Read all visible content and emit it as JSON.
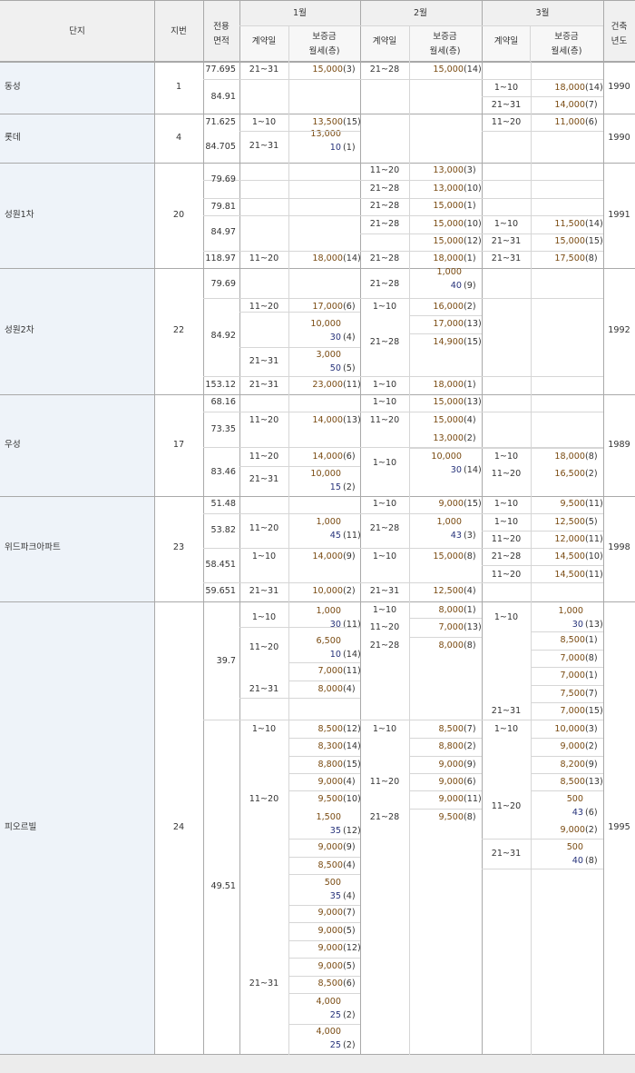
{
  "header": {
    "complex": "단지",
    "lot": "지번",
    "area": "전용\n면적",
    "contract": "계약일",
    "price": "보증금\n월세(층)",
    "year": "건축\n년도",
    "months": [
      "1월",
      "2월",
      "3월"
    ]
  },
  "complexes": [
    {
      "name": "동성",
      "lot": "1",
      "year": "1990"
    },
    {
      "name": "롯데",
      "lot": "4",
      "year": "1990"
    },
    {
      "name": "성원1차",
      "lot": "20",
      "year": "1991"
    },
    {
      "name": "성원2차",
      "lot": "22",
      "year": "1992"
    },
    {
      "name": "우성",
      "lot": "17",
      "year": "1989"
    },
    {
      "name": "위드파크아파트",
      "lot": "23",
      "year": "1998"
    },
    {
      "name": "피오르빌",
      "lot": "24",
      "year": "1995"
    }
  ],
  "areas": [
    "77.695",
    "84.91",
    "71.625",
    "84.705",
    "79.69",
    "79.81",
    "84.97",
    "118.97",
    "79.69",
    "84.92",
    "153.12",
    "68.16",
    "73.35",
    "83.46",
    "51.48",
    "53.82",
    "58.451",
    "59.651",
    "39.7",
    "49.51"
  ],
  "contracts": [
    "21~31",
    "21~28",
    "1~10",
    "21~31",
    "1~10",
    "11~20",
    "21~31",
    "11~20",
    "21~28",
    "21~28",
    "21~28",
    "1~10",
    "21~31",
    "11~20",
    "21~28",
    "21~31",
    "21~28",
    "11~20",
    "1~10",
    "21~28",
    "21~31",
    "21~31",
    "1~10",
    "1~10",
    "11~20",
    "11~20",
    "1~10",
    "1~10",
    "11~20",
    "21~31",
    "11~20",
    "1~10",
    "1~10",
    "11~20",
    "21~28",
    "1~10",
    "11~20",
    "1~10",
    "1~10",
    "21~28",
    "11~20",
    "21~31",
    "21~31",
    "1~10",
    "1~10",
    "1~10",
    "11~20",
    "11~20",
    "21~28",
    "21~31",
    "21~31",
    "1~10",
    "1~10",
    "1~10",
    "11~20",
    "11~20",
    "21~28",
    "11~20",
    "21~31",
    "21~31"
  ],
  "prices": [
    "15,000",
    "(3)",
    "15,000",
    "(14)",
    "18,000",
    "(14)",
    "14,000",
    "(7)",
    "13,500",
    "(15)",
    "11,000",
    "(6)",
    "13,000",
    "10",
    "(1)",
    "13,000",
    "(3)",
    "13,000",
    "(10)",
    "15,000",
    "(1)",
    "15,000",
    "(10)",
    "11,500",
    "(14)",
    "15,000",
    "(12)",
    "15,000",
    "(15)",
    "18,000",
    "(14)",
    "18,000",
    "(1)",
    "17,500",
    "(8)",
    "1,000",
    "40",
    "(9)",
    "17,000",
    "(6)",
    "16,000",
    "(2)",
    "10,000",
    "30",
    "(4)",
    "17,000",
    "(13)",
    "14,900",
    "(15)",
    "3,000",
    "50",
    "(5)",
    "23,000",
    "(11)",
    "18,000",
    "(1)",
    "15,000",
    "(13)",
    "14,000",
    "(13)",
    "15,000",
    "(4)",
    "13,000",
    "(2)",
    "14,000",
    "(6)",
    "10,000",
    "30",
    "(14)",
    "18,000",
    "(8)",
    "10,000",
    "15",
    "(2)",
    "16,500",
    "(2)",
    "9,000",
    "(15)",
    "9,500",
    "(11)",
    "1,000",
    "45",
    "(11)",
    "1,000",
    "43",
    "(3)",
    "12,500",
    "(5)",
    "12,000",
    "(11)",
    "14,000",
    "(9)",
    "15,000",
    "(8)",
    "14,500",
    "(10)",
    "14,500",
    "(11)",
    "10,000",
    "(2)",
    "12,500",
    "(4)",
    "1,000",
    "30",
    "(11)",
    "8,000",
    "(1)",
    "1,000",
    "30",
    "(13)",
    "7,000",
    "(13)",
    "6,500",
    "10",
    "(14)",
    "8,000",
    "(8)",
    "8,500",
    "(1)",
    "7,000",
    "(8)",
    "7,000",
    "(11)",
    "7,000",
    "(1)",
    "8,000",
    "(4)",
    "7,500",
    "(7)",
    "7,000",
    "(15)",
    "8,500",
    "(12)",
    "8,500",
    "(7)",
    "10,000",
    "(3)",
    "8,300",
    "(14)",
    "8,800",
    "(2)",
    "9,000",
    "(2)",
    "8,800",
    "(15)",
    "9,000",
    "(9)",
    "8,200",
    "(9)",
    "9,000",
    "(4)",
    "9,000",
    "(6)",
    "8,500",
    "(13)",
    "9,500",
    "(10)",
    "9,000",
    "(11)",
    "500",
    "43",
    "(6)",
    "1,500",
    "35",
    "(12)",
    "9,500",
    "(8)",
    "9,000",
    "(2)",
    "9,000",
    "(9)",
    "500",
    "40",
    "(8)",
    "8,500",
    "(4)",
    "500",
    "35",
    "(4)",
    "9,000",
    "(7)",
    "9,000",
    "(5)",
    "9,000",
    "(12)",
    "9,000",
    "(5)",
    "8,500",
    "(6)",
    "4,000",
    "25",
    "(2)",
    "4,000",
    "25",
    "(2)"
  ]
}
